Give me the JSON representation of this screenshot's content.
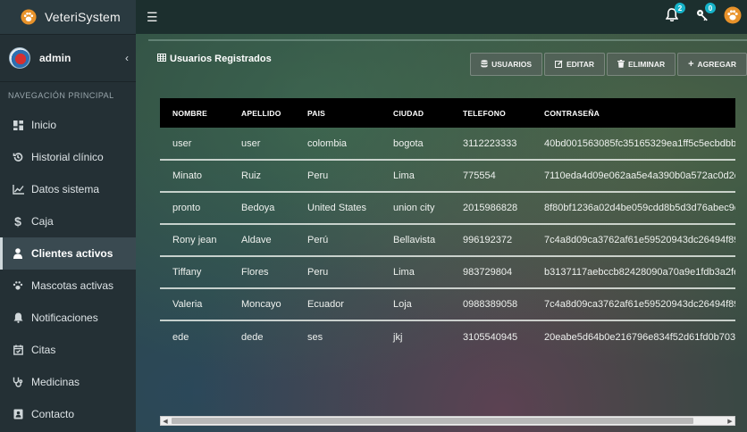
{
  "brand": {
    "name": "VeteriSystem"
  },
  "user": {
    "name": "admin"
  },
  "sidebar": {
    "header": "NAVEGACIÓN PRINCIPAL",
    "items": [
      {
        "label": "Inicio",
        "icon": "dashboard-icon"
      },
      {
        "label": "Historial clínico",
        "icon": "history-icon"
      },
      {
        "label": "Datos sistema",
        "icon": "line-chart-icon"
      },
      {
        "label": "Caja",
        "icon": "dollar-icon"
      },
      {
        "label": "Clientes activos",
        "icon": "user-icon",
        "active": true
      },
      {
        "label": "Mascotas activas",
        "icon": "paw-icon"
      },
      {
        "label": "Notificaciones",
        "icon": "bell-icon"
      },
      {
        "label": "Citas",
        "icon": "calendar-icon"
      },
      {
        "label": "Medicinas",
        "icon": "stethoscope-icon"
      },
      {
        "label": "Contacto",
        "icon": "address-book-icon"
      }
    ]
  },
  "topbar": {
    "notifications_count": "2",
    "keys_count": "0"
  },
  "box": {
    "title": "Usuarios Registrados",
    "buttons": {
      "usuarios": "USUARIOS",
      "editar": "EDITAR",
      "eliminar": "ELIMINAR",
      "agregar": "AGREGAR"
    }
  },
  "table": {
    "headers": [
      "NOMBRE",
      "APELLIDO",
      "PAIS",
      "CIUDAD",
      "TELEFONO",
      "CONTRASEÑA"
    ],
    "rows": [
      [
        "user",
        "user",
        "colombia",
        "bogota",
        "3112223333",
        "40bd001563085fc35165329ea1ff5c5ecbdbbeef"
      ],
      [
        "Minato",
        "Ruiz",
        "Peru",
        "Lima",
        "775554",
        "7110eda4d09e062aa5e4a390b0a572ac0d2c02"
      ],
      [
        "pronto",
        "Bedoya",
        "United States",
        "union city",
        "2015986828",
        "8f80bf1236a02d4be059cdd8b5d3d76abec9e"
      ],
      [
        "Rony jean",
        "Aldave",
        "Perú",
        "Bellavista",
        "996192372",
        "7c4a8d09ca3762af61e59520943dc26494f89"
      ],
      [
        "Tiffany",
        "Flores",
        "Peru",
        "Lima",
        "983729804",
        "b3137117aebccb82428090a70a9e1fdb3a2fe"
      ],
      [
        "Valeria",
        "Moncayo",
        "Ecuador",
        "Loja",
        "0988389058",
        "7c4a8d09ca3762af61e59520943dc26494f89"
      ],
      [
        "ede",
        "dede",
        "ses",
        "jkj",
        "3105540945",
        "20eabe5d64b0e216796e834f52d61fd0b7033"
      ]
    ]
  },
  "colors": {
    "badge": "#16b3c9",
    "paw_orange": "#e8922a",
    "table_header": "#000000"
  }
}
